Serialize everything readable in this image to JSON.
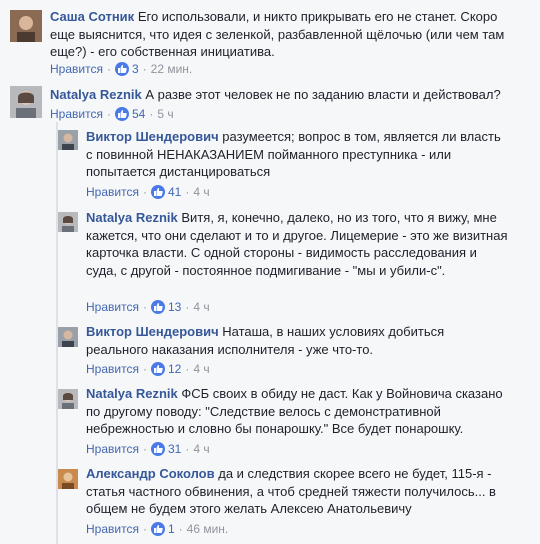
{
  "comments": [
    {
      "author": "Саша Сотник",
      "text": "Его использовали, и никто прикрывать его не станет. Скоро еще выяснится, что идея с зеленкой, разбавленной щёлочью (или чем там еще?) - его собственная инициатива.",
      "like_label": "Нравится",
      "likes": "3",
      "time": "22 мин."
    },
    {
      "author": "Natalya Reznik",
      "text": "А разве этот человек не по заданию власти и действовал?",
      "like_label": "Нравится",
      "likes": "54",
      "time": "5 ч"
    },
    {
      "author": "Виктор Шендерович",
      "text": "разумеется; вопрос в том, является ли власть с повинной НЕНАКАЗАНИЕМ пойманного преступника - или попытается дистанцироваться",
      "like_label": "Нравится",
      "likes": "41",
      "time": "4 ч"
    },
    {
      "author": "Natalya Reznik",
      "text": "Витя, я, конечно, далеко, но из того, что я вижу, мне кажется, что они сделают и то и другое. Лицемерие - это же визитная карточка власти. С одной стороны - видимость расследования и суда, с другой - постоянное подмигивание - \"мы и убили-с\".",
      "like_label": "Нравится",
      "likes": "13",
      "time": "4 ч"
    },
    {
      "author": "Виктор Шендерович",
      "text": "Наташа, в наших условиях добиться реального наказания исполнителя - уже что-то.",
      "like_label": "Нравится",
      "likes": "12",
      "time": "4 ч"
    },
    {
      "author": "Natalya Reznik",
      "text": "ФСБ своих в обиду не даст. Как у Войновича сказано по другому поводу: \"Следствие велось с демонстративной небрежностью и словно бы понарошку.\" Все будет понарошку.",
      "like_label": "Нравится",
      "likes": "31",
      "time": "4 ч"
    },
    {
      "author": "Александр Соколов",
      "text": "да и следствия скорее всего не будет, 115-я - статья частного обвинения, а чтоб средней тяжести получилось... в общем не будем этого желать Алексею Анатольевичу",
      "like_label": "Нравится",
      "likes": "1",
      "time": "46 мин."
    }
  ],
  "colors": {
    "author": "#365899",
    "like_badge": "#4a7ae8",
    "meta": "#90949c"
  },
  "icons": {
    "like": "thumbs-up-icon"
  }
}
